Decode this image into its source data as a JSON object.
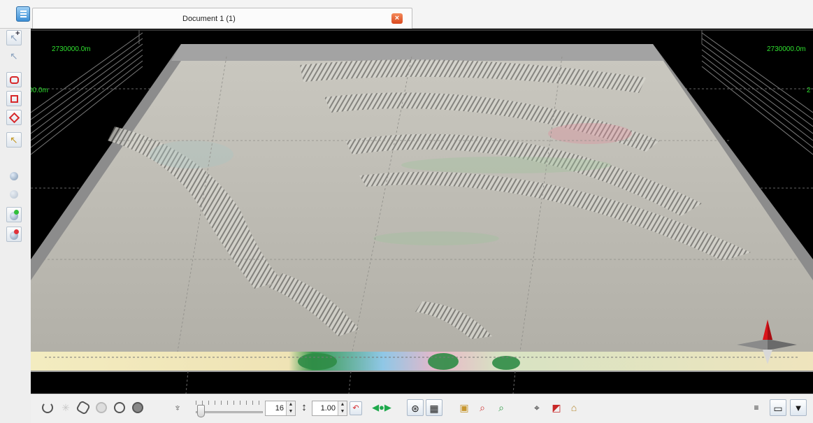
{
  "tab": {
    "title": "Document 1 (1)",
    "close_glyph": "×"
  },
  "view": {
    "grid_labels": {
      "top_left": "2730000.0m",
      "left_clipped": "00.0m",
      "top_right": "2730000.0m",
      "right_clipped": "2"
    },
    "colors": {
      "grid_label": "#2fe02f",
      "background": "#000000",
      "terrain": "#bebdb6",
      "frame": "#8c8c8c"
    }
  },
  "left_toolbar": {
    "icons": [
      "select-add-icon",
      "select-arrow-icon",
      "polygon-select-icon",
      "rectangle-select-icon",
      "diamond-select-icon",
      "edit-select-icon",
      "globe-camera-icon",
      "globe-light-icon",
      "globe-green-icon",
      "globe-red-icon"
    ]
  },
  "bottom_toolbar": {
    "slider_value": "16",
    "vertical_exaggeration": "1.00",
    "icons": [
      "rotate-icon",
      "sun-icon",
      "cube-icon",
      "sphere-icon",
      "octagon-icon",
      "texture-icon",
      "light-icon",
      "vertical-scale-icon",
      "reset-red-icon",
      "navigate-arrows-icon",
      "compass-circle-icon",
      "grid-icon",
      "zoom-extent-icon",
      "zoom-in-red-icon",
      "zoom-green-icon",
      "target-icon",
      "eraser-icon",
      "home-icon",
      "menu-lines-icon",
      "window-icon",
      "dropdown-arrow-icon"
    ]
  }
}
